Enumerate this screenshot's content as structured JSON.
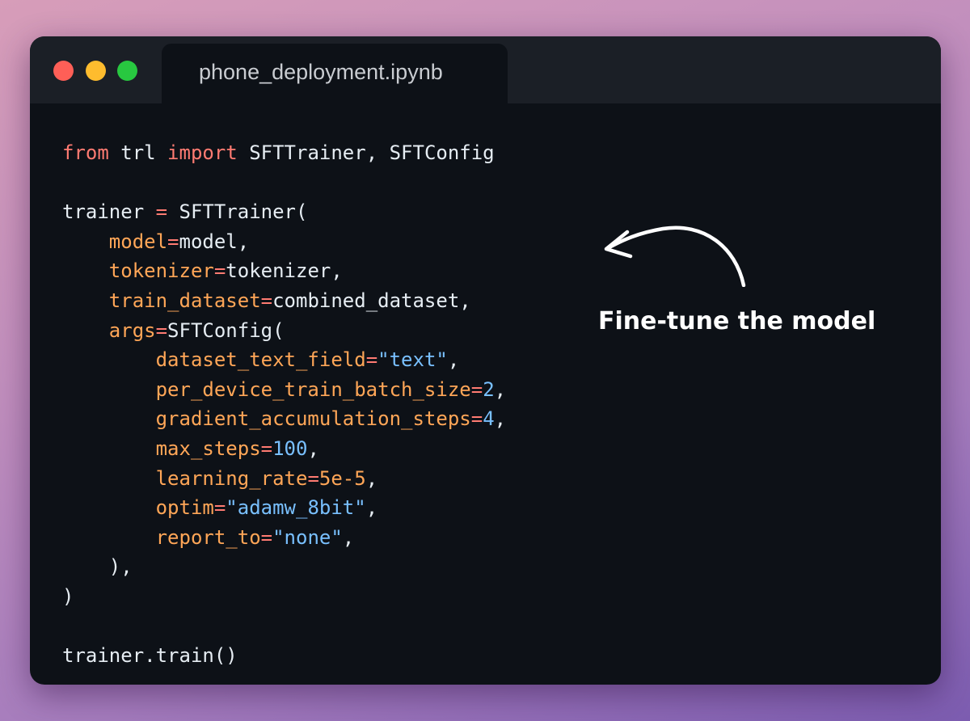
{
  "window": {
    "tab_title": "phone_deployment.ipynb",
    "controls": [
      "close",
      "minimize",
      "maximize"
    ]
  },
  "code": {
    "language": "python",
    "lines": [
      [
        {
          "t": "from",
          "c": "kw"
        },
        {
          "t": " trl ",
          "c": "plain"
        },
        {
          "t": "import",
          "c": "kw"
        },
        {
          "t": " SFTTrainer, SFTConfig",
          "c": "plain"
        }
      ],
      [],
      [
        {
          "t": "trainer ",
          "c": "plain"
        },
        {
          "t": "=",
          "c": "op"
        },
        {
          "t": " SFTTrainer(",
          "c": "plain"
        }
      ],
      [
        {
          "t": "    ",
          "c": "plain"
        },
        {
          "t": "model",
          "c": "param"
        },
        {
          "t": "=",
          "c": "op"
        },
        {
          "t": "model,",
          "c": "plain"
        }
      ],
      [
        {
          "t": "    ",
          "c": "plain"
        },
        {
          "t": "tokenizer",
          "c": "param"
        },
        {
          "t": "=",
          "c": "op"
        },
        {
          "t": "tokenizer,",
          "c": "plain"
        }
      ],
      [
        {
          "t": "    ",
          "c": "plain"
        },
        {
          "t": "train_dataset",
          "c": "param"
        },
        {
          "t": "=",
          "c": "op"
        },
        {
          "t": "combined_dataset,",
          "c": "plain"
        }
      ],
      [
        {
          "t": "    ",
          "c": "plain"
        },
        {
          "t": "args",
          "c": "param"
        },
        {
          "t": "=",
          "c": "op"
        },
        {
          "t": "SFTConfig(",
          "c": "plain"
        }
      ],
      [
        {
          "t": "        ",
          "c": "plain"
        },
        {
          "t": "dataset_text_field",
          "c": "param"
        },
        {
          "t": "=",
          "c": "op"
        },
        {
          "t": "\"text\"",
          "c": "str"
        },
        {
          "t": ",",
          "c": "plain"
        }
      ],
      [
        {
          "t": "        ",
          "c": "plain"
        },
        {
          "t": "per_device_train_batch_size",
          "c": "param"
        },
        {
          "t": "=",
          "c": "op"
        },
        {
          "t": "2",
          "c": "num"
        },
        {
          "t": ",",
          "c": "plain"
        }
      ],
      [
        {
          "t": "        ",
          "c": "plain"
        },
        {
          "t": "gradient_accumulation_steps",
          "c": "param"
        },
        {
          "t": "=",
          "c": "op"
        },
        {
          "t": "4",
          "c": "num"
        },
        {
          "t": ",",
          "c": "plain"
        }
      ],
      [
        {
          "t": "        ",
          "c": "plain"
        },
        {
          "t": "max_steps",
          "c": "param"
        },
        {
          "t": "=",
          "c": "op"
        },
        {
          "t": "100",
          "c": "num"
        },
        {
          "t": ",",
          "c": "plain"
        }
      ],
      [
        {
          "t": "        ",
          "c": "plain"
        },
        {
          "t": "learning_rate",
          "c": "param"
        },
        {
          "t": "=",
          "c": "op"
        },
        {
          "t": "5e-5",
          "c": "param"
        },
        {
          "t": ",",
          "c": "plain"
        }
      ],
      [
        {
          "t": "        ",
          "c": "plain"
        },
        {
          "t": "optim",
          "c": "param"
        },
        {
          "t": "=",
          "c": "op"
        },
        {
          "t": "\"adamw_8bit\"",
          "c": "str"
        },
        {
          "t": ",",
          "c": "plain"
        }
      ],
      [
        {
          "t": "        ",
          "c": "plain"
        },
        {
          "t": "report_to",
          "c": "param"
        },
        {
          "t": "=",
          "c": "op"
        },
        {
          "t": "\"none\"",
          "c": "str"
        },
        {
          "t": ",",
          "c": "plain"
        }
      ],
      [
        {
          "t": "    ),",
          "c": "plain"
        }
      ],
      [
        {
          "t": ")",
          "c": "plain"
        }
      ],
      [],
      [
        {
          "t": "trainer.train()",
          "c": "plain"
        }
      ]
    ]
  },
  "annotation": {
    "text": "Fine-tune the model",
    "icon": "curved-arrow-icon"
  },
  "colors": {
    "background_gradient": [
      "#d79db9",
      "#7c5cb0"
    ],
    "window": "#0d1117",
    "titlebar": "#1b1f26",
    "keyword": "#ff7b72",
    "parameter": "#ffa657",
    "string_number": "#79c0ff",
    "text": "#e6edf3"
  }
}
